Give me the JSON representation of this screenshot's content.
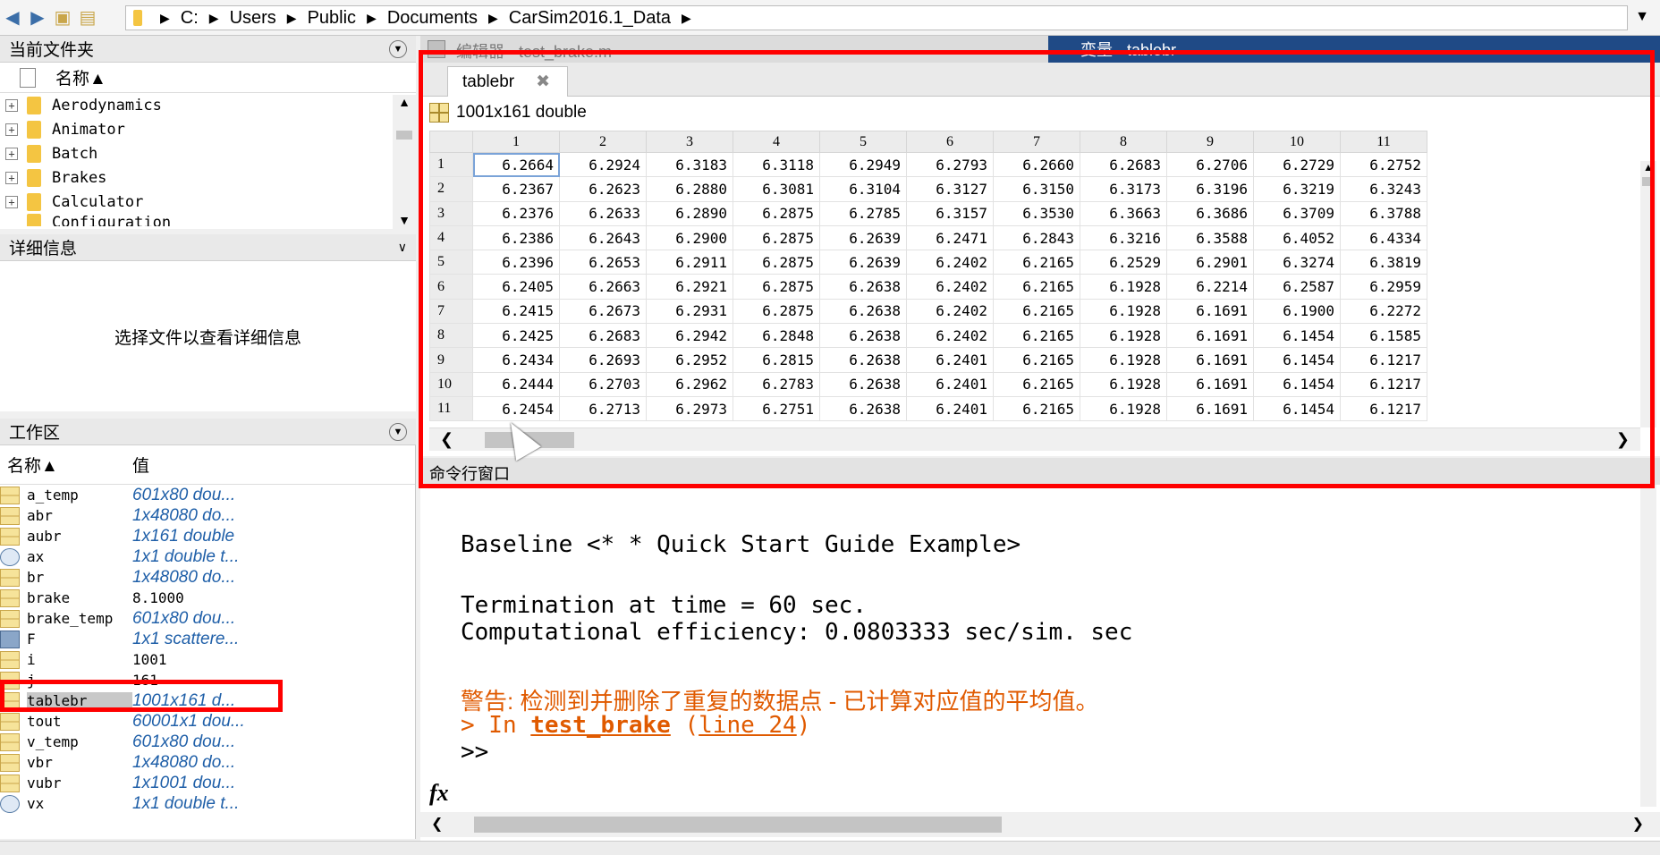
{
  "address": {
    "path": [
      "C:",
      "Users",
      "Public",
      "Documents",
      "CarSim2016.1_Data"
    ]
  },
  "folder_panel": {
    "title": "当前文件夹",
    "column": "名称▲",
    "items": [
      "Aerodynamics",
      "Animator",
      "Batch",
      "Brakes",
      "Calculator",
      "Configuration"
    ]
  },
  "detail_panel": {
    "title": "详细信息",
    "message": "选择文件以查看详细信息"
  },
  "workspace": {
    "title": "工作区",
    "col_name": "名称▲",
    "col_value": "值",
    "vars": [
      {
        "name": "a_temp",
        "value": "601x80 dou...",
        "icon": "matrix-icon",
        "italic": true
      },
      {
        "name": "abr",
        "value": "1x48080 do...",
        "icon": "matrix-icon",
        "italic": true
      },
      {
        "name": "aubr",
        "value": "1x161 double",
        "icon": "matrix-icon",
        "italic": true
      },
      {
        "name": "ax",
        "value": "1x1 double t...",
        "icon": "timeseries-icon",
        "italic": true
      },
      {
        "name": "br",
        "value": "1x48080 do...",
        "icon": "matrix-icon",
        "italic": true
      },
      {
        "name": "brake",
        "value": "8.1000",
        "icon": "matrix-icon",
        "italic": false
      },
      {
        "name": "brake_temp",
        "value": "601x80 dou...",
        "icon": "matrix-icon",
        "italic": true
      },
      {
        "name": "F",
        "value": "1x1 scattere...",
        "icon": "object-icon",
        "italic": true
      },
      {
        "name": "i",
        "value": "1001",
        "icon": "matrix-icon",
        "italic": false
      },
      {
        "name": "j",
        "value": "161",
        "icon": "matrix-icon",
        "italic": false
      },
      {
        "name": "tablebr",
        "value": "1001x161 d...",
        "icon": "matrix-icon",
        "italic": true,
        "selected": true
      },
      {
        "name": "tout",
        "value": "60001x1 dou...",
        "icon": "matrix-icon",
        "italic": true
      },
      {
        "name": "v_temp",
        "value": "601x80 dou...",
        "icon": "matrix-icon",
        "italic": true
      },
      {
        "name": "vbr",
        "value": "1x48080 do...",
        "icon": "matrix-icon",
        "italic": true
      },
      {
        "name": "vubr",
        "value": "1x1001 dou...",
        "icon": "matrix-icon",
        "italic": true
      },
      {
        "name": "vx",
        "value": "1x1 double t...",
        "icon": "timeseries-icon",
        "italic": true
      }
    ]
  },
  "editor_strip": {
    "editor_label": "编辑器 - test_brake.m",
    "variable_label": "变量 - tablebr"
  },
  "variable_editor": {
    "tab": "tablebr",
    "info": "1001x161 double",
    "col_headers": [
      "1",
      "2",
      "3",
      "4",
      "5",
      "6",
      "7",
      "8",
      "9",
      "10",
      "11"
    ],
    "rows": [
      {
        "h": "1",
        "v": [
          "6.2664",
          "6.2924",
          "6.3183",
          "6.3118",
          "6.2949",
          "6.2793",
          "6.2660",
          "6.2683",
          "6.2706",
          "6.2729",
          "6.2752"
        ]
      },
      {
        "h": "2",
        "v": [
          "6.2367",
          "6.2623",
          "6.2880",
          "6.3081",
          "6.3104",
          "6.3127",
          "6.3150",
          "6.3173",
          "6.3196",
          "6.3219",
          "6.3243"
        ]
      },
      {
        "h": "3",
        "v": [
          "6.2376",
          "6.2633",
          "6.2890",
          "6.2875",
          "6.2785",
          "6.3157",
          "6.3530",
          "6.3663",
          "6.3686",
          "6.3709",
          "6.3788"
        ]
      },
      {
        "h": "4",
        "v": [
          "6.2386",
          "6.2643",
          "6.2900",
          "6.2875",
          "6.2639",
          "6.2471",
          "6.2843",
          "6.3216",
          "6.3588",
          "6.4052",
          "6.4334"
        ]
      },
      {
        "h": "5",
        "v": [
          "6.2396",
          "6.2653",
          "6.2911",
          "6.2875",
          "6.2639",
          "6.2402",
          "6.2165",
          "6.2529",
          "6.2901",
          "6.3274",
          "6.3819"
        ]
      },
      {
        "h": "6",
        "v": [
          "6.2405",
          "6.2663",
          "6.2921",
          "6.2875",
          "6.2638",
          "6.2402",
          "6.2165",
          "6.1928",
          "6.2214",
          "6.2587",
          "6.2959"
        ]
      },
      {
        "h": "7",
        "v": [
          "6.2415",
          "6.2673",
          "6.2931",
          "6.2875",
          "6.2638",
          "6.2402",
          "6.2165",
          "6.1928",
          "6.1691",
          "6.1900",
          "6.2272"
        ]
      },
      {
        "h": "8",
        "v": [
          "6.2425",
          "6.2683",
          "6.2942",
          "6.2848",
          "6.2638",
          "6.2402",
          "6.2165",
          "6.1928",
          "6.1691",
          "6.1454",
          "6.1585"
        ]
      },
      {
        "h": "9",
        "v": [
          "6.2434",
          "6.2693",
          "6.2952",
          "6.2815",
          "6.2638",
          "6.2401",
          "6.2165",
          "6.1928",
          "6.1691",
          "6.1454",
          "6.1217"
        ]
      },
      {
        "h": "10",
        "v": [
          "6.2444",
          "6.2703",
          "6.2962",
          "6.2783",
          "6.2638",
          "6.2401",
          "6.2165",
          "6.1928",
          "6.1691",
          "6.1454",
          "6.1217"
        ]
      },
      {
        "h": "11",
        "v": [
          "6.2454",
          "6.2713",
          "6.2973",
          "6.2751",
          "6.2638",
          "6.2401",
          "6.2165",
          "6.1928",
          "6.1691",
          "6.1454",
          "6.1217"
        ]
      }
    ]
  },
  "command_window": {
    "title": "命令行窗口",
    "lines": {
      "baseline": "Baseline <* * Quick Start Guide Example>",
      "termination": "Termination at time = 60 sec.",
      "efficiency": "Computational efficiency: 0.0803333 sec/sim. sec",
      "warning": "警告: 检测到并删除了重复的数据点 - 已计算对应值的平均值。",
      "in_prefix": "> In ",
      "in_func": "test_brake",
      "in_line": "line 24",
      "prompt": ">>"
    },
    "fx": "fx"
  },
  "colors": {
    "highlight": "#ff0000",
    "warning": "#e05a00",
    "link": "#1f5fa8"
  }
}
